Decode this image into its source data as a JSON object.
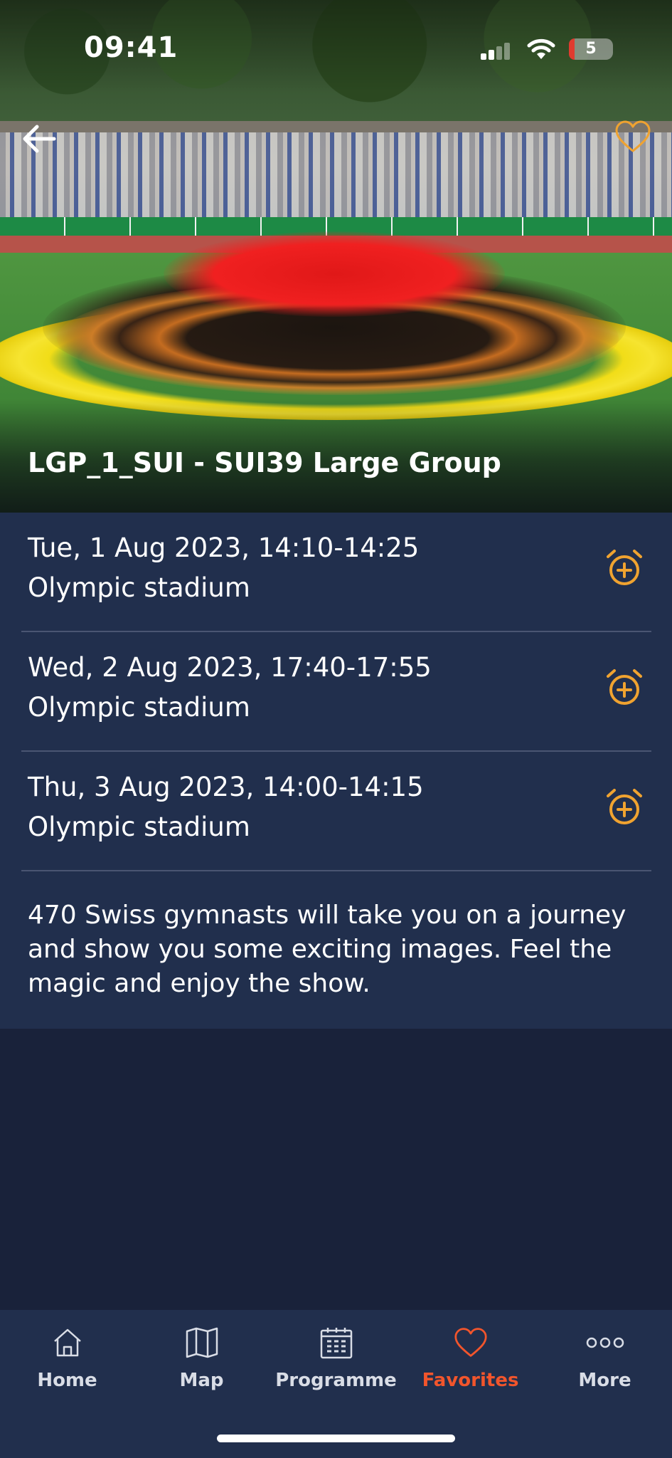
{
  "status_bar": {
    "time": "09:41",
    "battery_level": "5"
  },
  "header": {
    "back_icon": "arrow-left-icon",
    "favorite_icon": "heart-outline-icon",
    "title": "LGP_1_SUI - SUI39 Large Group"
  },
  "schedule": [
    {
      "when": "Tue, 1 Aug 2023, 14:10-14:25",
      "where": "Olympic stadium",
      "icon": "alarm-plus-icon"
    },
    {
      "when": "Wed, 2 Aug 2023, 17:40-17:55",
      "where": "Olympic stadium",
      "icon": "alarm-plus-icon"
    },
    {
      "when": "Thu, 3 Aug 2023, 14:00-14:15",
      "where": "Olympic stadium",
      "icon": "alarm-plus-icon"
    }
  ],
  "description": "470 Swiss gymnasts will take you on a journey and show you some exciting images. Feel the magic and enjoy the show.",
  "tabs": [
    {
      "label": "Home",
      "icon": "house-icon",
      "active": false
    },
    {
      "label": "Map",
      "icon": "map-icon",
      "active": false
    },
    {
      "label": "Programme",
      "icon": "calendar-icon",
      "active": false
    },
    {
      "label": "Favorites",
      "icon": "heart-icon",
      "active": true
    },
    {
      "label": "More",
      "icon": "more-dots-icon",
      "active": false
    }
  ],
  "colors": {
    "background": "#19223a",
    "card": "#212f4d",
    "accent_orange": "#f0a330",
    "active_tab": "#f2552c",
    "divider": "#4a5572"
  }
}
